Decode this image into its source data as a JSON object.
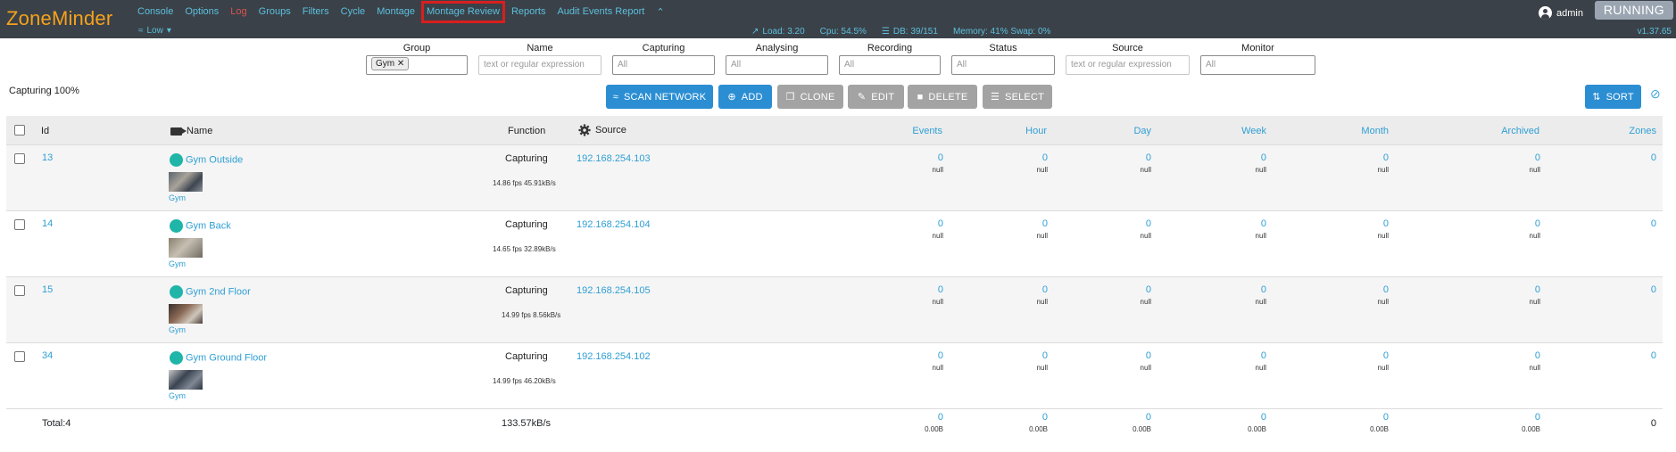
{
  "brand": "ZoneMinder",
  "nav": {
    "items": [
      "Console",
      "Options",
      "Log",
      "Groups",
      "Filters",
      "Cycle",
      "Montage",
      "Montage Review",
      "Reports",
      "Audit Events Report"
    ],
    "highlighted": "Montage Review",
    "bandwidth": "Low"
  },
  "status": {
    "load": "Load: 3.20",
    "cpu": "Cpu: 54.5%",
    "db": "DB: 39/151",
    "memory": "Memory: 41% Swap: 0%"
  },
  "user": {
    "name": "admin",
    "state": "RUNNING",
    "version": "v1.37.65"
  },
  "filters": {
    "group": {
      "label": "Group",
      "chip": "Gym"
    },
    "name": {
      "label": "Name",
      "placeholder": "text or regular expression"
    },
    "capturing": {
      "label": "Capturing",
      "value": "All"
    },
    "analysing": {
      "label": "Analysing",
      "value": "All"
    },
    "recording": {
      "label": "Recording",
      "value": "All"
    },
    "status": {
      "label": "Status",
      "value": "All"
    },
    "source": {
      "label": "Source",
      "placeholder": "text or regular expression"
    },
    "monitor": {
      "label": "Monitor",
      "value": "All"
    }
  },
  "toolbar": {
    "capturing_pct": "Capturing 100%",
    "scan_network": "SCAN NETWORK",
    "add": "ADD",
    "clone": "CLONE",
    "edit": "EDIT",
    "delete": "DELETE",
    "select": "SELECT",
    "sort": "SORT"
  },
  "table": {
    "headers": {
      "id": "Id",
      "name": "Name",
      "function": "Function",
      "source": "Source",
      "events": "Events",
      "hour": "Hour",
      "day": "Day",
      "week": "Week",
      "month": "Month",
      "archived": "Archived",
      "zones": "Zones"
    },
    "rows": [
      {
        "id": "13",
        "name": "Gym Outside",
        "group": "Gym",
        "function": "Capturing",
        "fps": "14.86 fps 45.91kB/s",
        "source": "192.168.254.103",
        "events": "0",
        "hour": "0",
        "day": "0",
        "week": "0",
        "month": "0",
        "archived": "0",
        "zones": "0",
        "sub": "null"
      },
      {
        "id": "14",
        "name": "Gym Back",
        "group": "Gym",
        "function": "Capturing",
        "fps": "14.65 fps 32.89kB/s",
        "source": "192.168.254.104",
        "events": "0",
        "hour": "0",
        "day": "0",
        "week": "0",
        "month": "0",
        "archived": "0",
        "zones": "0",
        "sub": "null"
      },
      {
        "id": "15",
        "name": "Gym 2nd Floor",
        "group": "Gym",
        "function": "Capturing",
        "fps": "14.99 fps 8.56kB/s",
        "source": "192.168.254.105",
        "events": "0",
        "hour": "0",
        "day": "0",
        "week": "0",
        "month": "0",
        "archived": "0",
        "zones": "0",
        "sub": "null"
      },
      {
        "id": "34",
        "name": "Gym Ground Floor",
        "group": "Gym",
        "function": "Capturing",
        "fps": "14.99 fps 46.20kB/s",
        "source": "192.168.254.102",
        "events": "0",
        "hour": "0",
        "day": "0",
        "week": "0",
        "month": "0",
        "archived": "0",
        "zones": "0",
        "sub": "null"
      }
    ],
    "footer": {
      "total": "Total:4",
      "bandwidth": "133.57kB/s",
      "events": "0",
      "hour": "0",
      "day": "0",
      "week": "0",
      "month": "0",
      "archived": "0",
      "zones": "0",
      "size": "0.00B"
    }
  }
}
